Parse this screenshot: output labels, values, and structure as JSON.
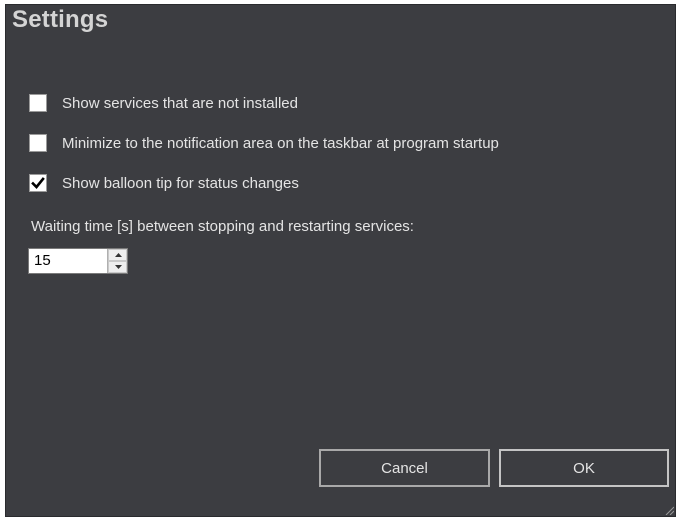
{
  "window": {
    "title": "Settings"
  },
  "options": [
    {
      "label": "Show services that are not installed",
      "checked": false
    },
    {
      "label": "Minimize to the notification area on the taskbar at program startup",
      "checked": false
    },
    {
      "label": "Show balloon tip for status changes",
      "checked": true
    }
  ],
  "waiting_time": {
    "label": "Waiting time [s] between stopping and restarting services:",
    "value": "15"
  },
  "buttons": {
    "cancel_label": "Cancel",
    "ok_label": "OK"
  },
  "colors": {
    "window_background": "#3c3d41",
    "text": "#e4e4e4",
    "title": "#d4d4d4"
  }
}
